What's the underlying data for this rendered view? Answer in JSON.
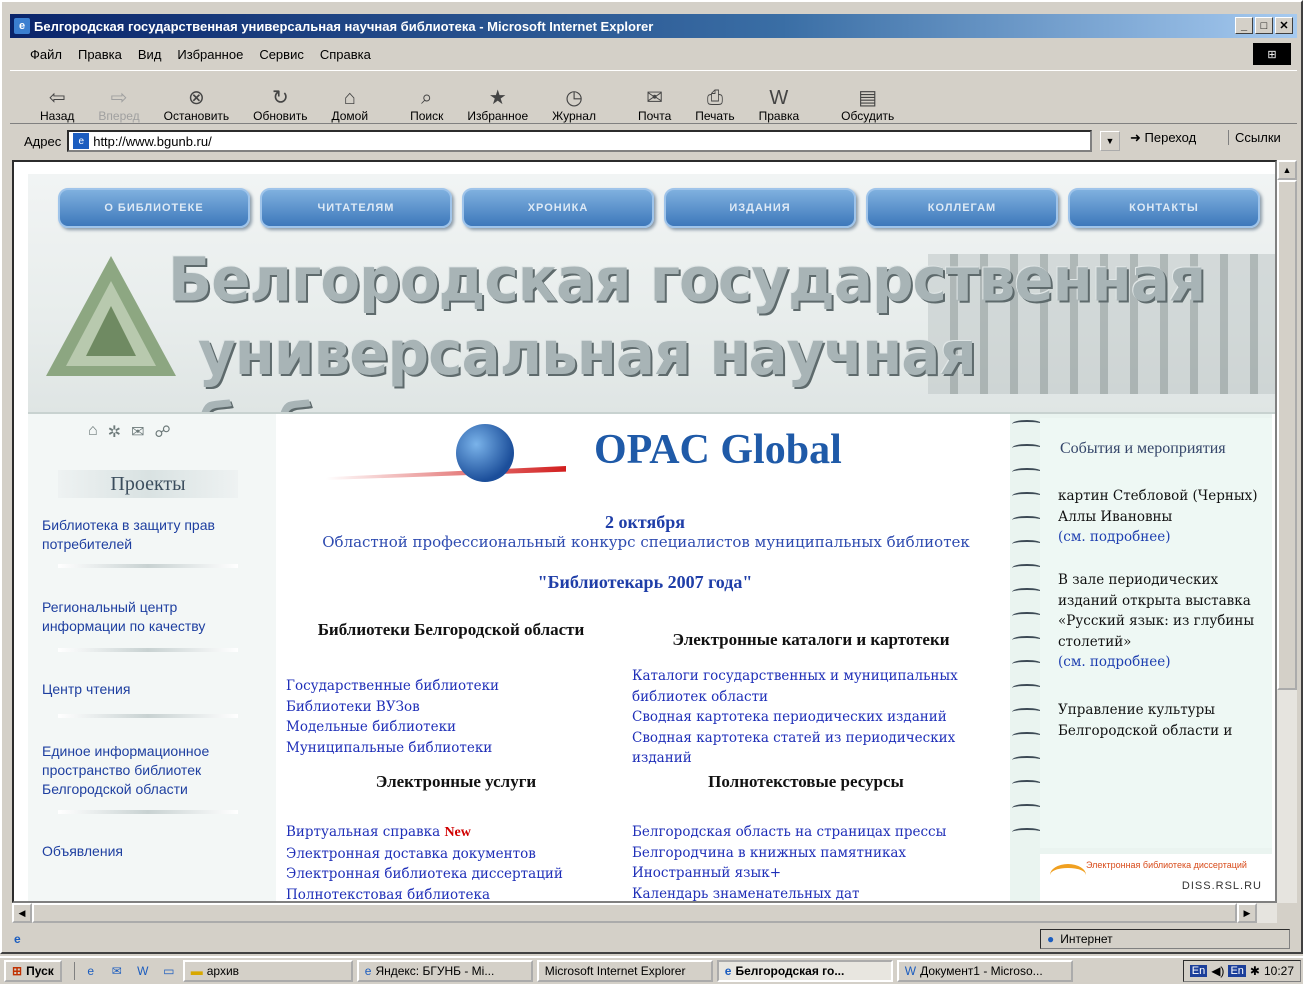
{
  "window": {
    "title": "Белгородская государственная универсальная научная библиотека - Microsoft Internet Explorer"
  },
  "menu": [
    "Файл",
    "Правка",
    "Вид",
    "Избранное",
    "Сервис",
    "Справка"
  ],
  "toolbar": [
    {
      "label": "Назад",
      "icon": "back-arrow-icon",
      "glyph": "⇦",
      "disabled": false
    },
    {
      "label": "Вперед",
      "icon": "forward-arrow-icon",
      "glyph": "⇨",
      "disabled": true
    },
    {
      "label": "Остановить",
      "icon": "stop-icon",
      "glyph": "⊗",
      "disabled": false
    },
    {
      "label": "Обновить",
      "icon": "refresh-icon",
      "glyph": "↻",
      "disabled": false
    },
    {
      "label": "Домой",
      "icon": "home-icon",
      "glyph": "⌂",
      "disabled": false
    },
    {
      "label": "Поиск",
      "icon": "search-icon",
      "glyph": "⌕",
      "disabled": false
    },
    {
      "label": "Избранное",
      "icon": "favorites-icon",
      "glyph": "★",
      "disabled": false
    },
    {
      "label": "Журнал",
      "icon": "history-icon",
      "glyph": "◷",
      "disabled": false
    },
    {
      "label": "Почта",
      "icon": "mail-icon",
      "glyph": "✉",
      "disabled": false
    },
    {
      "label": "Печать",
      "icon": "print-icon",
      "glyph": "⎙",
      "disabled": false
    },
    {
      "label": "Правка",
      "icon": "edit-icon",
      "glyph": "W",
      "disabled": false
    },
    {
      "label": "Обсудить",
      "icon": "discuss-icon",
      "glyph": "▤",
      "disabled": false
    }
  ],
  "address": {
    "label": "Адрес",
    "url": "http://www.bgunb.ru/",
    "go_label": "Переход",
    "links_label": "Ссылки"
  },
  "site": {
    "nav": [
      "О БИБЛИОТЕКЕ",
      "ЧИТАТЕЛЯМ",
      "ХРОНИКА",
      "ИЗДАНИЯ",
      "КОЛЛЕГАМ",
      "КОНТАКТЫ"
    ],
    "banner_line1": "Белгородская государственная",
    "banner_line2": "универсальная научная библиотека",
    "projects_title": "Проекты",
    "projects": [
      "Библиотека в защиту прав потребителей",
      "Региональный центр информации по качеству",
      "Центр чтения",
      "Единое информационное пространство библиотек Белгородской области",
      "Объявления"
    ],
    "opac_title": "OPAC Global",
    "news_date": "2 октября",
    "news_text": "Областной профессиональный конкурс специалистов муниципальных библиотек",
    "news_sub": "\"Библиотекарь 2007 года\"",
    "sections": {
      "libs": {
        "title": "Библиотеки Белгородской области",
        "links": [
          "Государственные библиотеки",
          "Библиотеки ВУЗов",
          "Модельные библиотеки",
          "Муниципальные библиотеки"
        ]
      },
      "catalogs": {
        "title": "Электронные каталоги и картотеки",
        "links": [
          "Каталоги государственных и муниципальных библиотек области",
          "Сводная картотека периодических изданий",
          "Сводная картотека статей из периодических изданий"
        ]
      },
      "services": {
        "title": "Электронные услуги",
        "links": [
          "Виртуальная справка",
          "Электронная доставка документов",
          "Электронная библиотека диссертаций",
          "Полнотекстовая библиотека"
        ],
        "new_badge": "New"
      },
      "fulltext": {
        "title": "Полнотекстовые ресурсы",
        "links": [
          "Белгородская область на страницах прессы",
          "Белгородчина в книжных памятниках",
          "Иностранный язык+",
          "Календарь знаменательных дат"
        ]
      }
    },
    "events": {
      "title": "События и мероприятия",
      "item1_text": "картин Стебловой (Черных) Аллы Ивановны",
      "item1_link": "(см. подробнее)",
      "item2_text": "В зале периодических изданий открыта выставка «Русский язык: из глубины столетий»",
      "item2_link": "(см. подробнее)",
      "item3_text": "Управление культуры Белгородской области и"
    },
    "diss_small": "Электронная библиотека диссертаций",
    "diss_big": "DISS.RSL.RU"
  },
  "status": {
    "zone": "Интернет"
  },
  "taskbar": {
    "start": "Пуск",
    "tasks": [
      {
        "label": "архив",
        "active": false
      },
      {
        "label": "Яндекс: БГУНБ - Mi...",
        "active": false
      },
      {
        "label": "Microsoft Internet Explorer",
        "active": false
      },
      {
        "label": "Белгородская го...",
        "active": true
      },
      {
        "label": "Документ1 - Microso...",
        "active": false
      }
    ],
    "lang": "En",
    "lang2": "En",
    "clock": "10:27"
  }
}
